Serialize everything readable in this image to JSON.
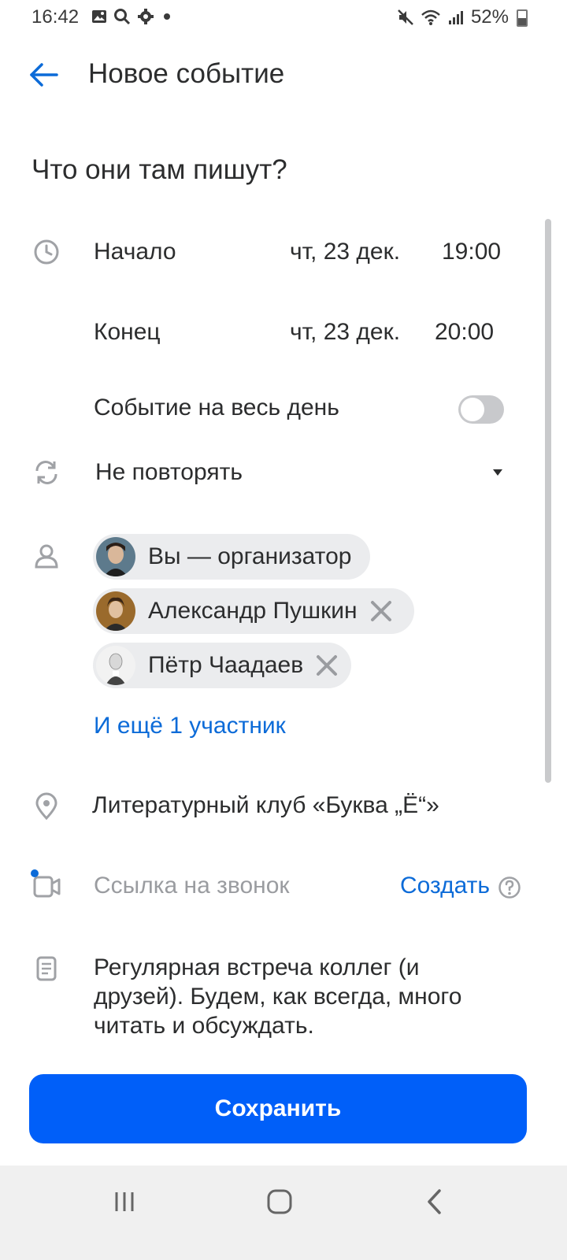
{
  "status_bar": {
    "time": "16:42",
    "battery": "52%",
    "icons_left": [
      "image-icon",
      "search-icon",
      "gear-icon",
      "dot-icon"
    ],
    "icons_right": [
      "mute-icon",
      "wifi-icon",
      "signal-icon",
      "battery-icon"
    ]
  },
  "header": {
    "title": "Новое событие",
    "back_icon": "arrow-left-icon"
  },
  "event": {
    "subject": "Что они там пишут?",
    "start": {
      "label": "Начало",
      "date": "чт, 23 дек.",
      "time": "19:00"
    },
    "end": {
      "label": "Конец",
      "date": "чт, 23 дек.",
      "time": "20:00"
    },
    "all_day": {
      "label": "Событие на весь день",
      "enabled": false
    },
    "repeat": {
      "value": "Не повторять"
    },
    "participants": [
      {
        "name": "Вы — организатор",
        "removable": false
      },
      {
        "name": "Александр Пушкин",
        "removable": true
      },
      {
        "name": "Пётр Чаадаев",
        "removable": true
      }
    ],
    "more_participants": "И ещё 1 участник",
    "location": "Литературный клуб «Буква „Ё“»",
    "call_link": {
      "placeholder": "Ссылка на звонок",
      "create_label": "Создать"
    },
    "description": "Регулярная встреча коллег (и друзей). Будем, как всегда, много читать и обсуждать."
  },
  "save_button": "Сохранить",
  "colors": {
    "accent": "#005ff9",
    "link": "#0c6bd8",
    "chip_bg": "#ebecee",
    "icon_gray": "#a0a2a6"
  }
}
